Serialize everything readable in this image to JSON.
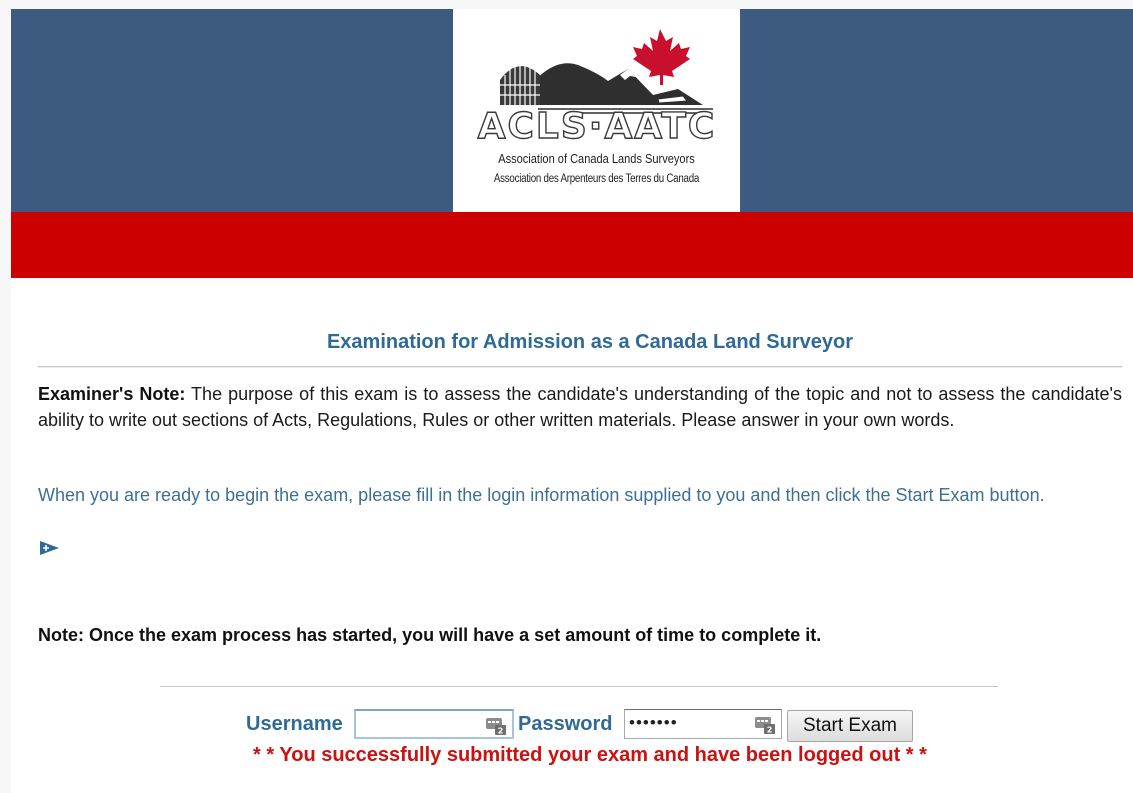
{
  "header": {
    "logo": {
      "wordmark": "ACLS·AATC",
      "subtitle_en": "Association of Canada Lands Surveyors",
      "subtitle_fr": "Association des Arpenteurs des Terres du Canada"
    },
    "colors": {
      "blue_band": "#3d5a80",
      "red_band": "#cc0000"
    }
  },
  "main": {
    "title": "Examination for Admission as a Canada Land Surveyor",
    "examiner_note_label": "Examiner's Note:",
    "examiner_note_text": " The purpose of this exam is to assess the candidate's understanding of the topic and not to assess the candidate's ability to write out sections of Acts, Regulations, Rules or other written materials. Please answer in your own words.",
    "ready_text": "When you are ready to begin the exam, please fill in the login information supplied to you and then click the Start Exam button.",
    "expand_icon": "arrow-right-icon",
    "time_note": "Note: Once the exam process has started, you will have a set amount of time to complete it."
  },
  "login": {
    "username_label": "Username",
    "username_value": "",
    "password_label": "Password",
    "password_value": "•••••••",
    "field_icon": "password-manager-key-icon",
    "start_button": "Start Exam",
    "status_message": "* * You successfully submitted your exam and have been logged out * *"
  }
}
